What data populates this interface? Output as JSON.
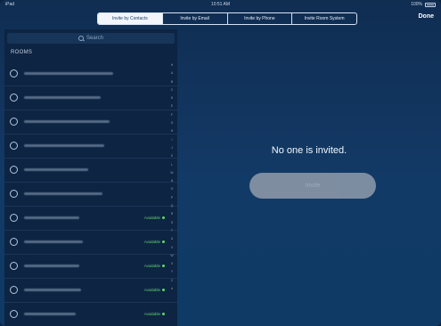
{
  "status_bar": {
    "carrier": "iPad",
    "time": "10:51 AM",
    "battery": "100%"
  },
  "nav": {
    "tabs": [
      {
        "label": "Invite by Contacts",
        "active": true
      },
      {
        "label": "Invite by Email",
        "active": false
      },
      {
        "label": "Invite by Phone",
        "active": false
      },
      {
        "label": "Invite Room System",
        "active": false
      }
    ],
    "done_label": "Done"
  },
  "sidebar": {
    "search_placeholder": "Search",
    "section_title": "ROOMS",
    "rooms": [
      {
        "status": "",
        "blur_width": 100
      },
      {
        "status": "",
        "blur_width": 86
      },
      {
        "status": "",
        "blur_width": 96
      },
      {
        "status": "",
        "blur_width": 90
      },
      {
        "status": "",
        "blur_width": 72
      },
      {
        "status": "",
        "blur_width": 88
      },
      {
        "status": "Available",
        "blur_width": 62
      },
      {
        "status": "Available",
        "blur_width": 66
      },
      {
        "status": "Available",
        "blur_width": 62
      },
      {
        "status": "Available",
        "blur_width": 64
      },
      {
        "status": "Available",
        "blur_width": 58
      }
    ],
    "index_letters": [
      "H",
      "A",
      "B",
      "C",
      "D",
      "E",
      "F",
      "G",
      "H",
      "I",
      "J",
      "K",
      "L",
      "M",
      "N",
      "O",
      "P",
      "Q",
      "R",
      "S",
      "T",
      "U",
      "V",
      "W",
      "X",
      "Y",
      "Z",
      "#"
    ]
  },
  "main": {
    "empty_message": "No one is invited.",
    "invite_label": "Invite"
  },
  "colors": {
    "background": "#123a66",
    "sidebar": "#0d2442",
    "available": "#5fcf6a",
    "invite_button": "#8a97a7"
  }
}
